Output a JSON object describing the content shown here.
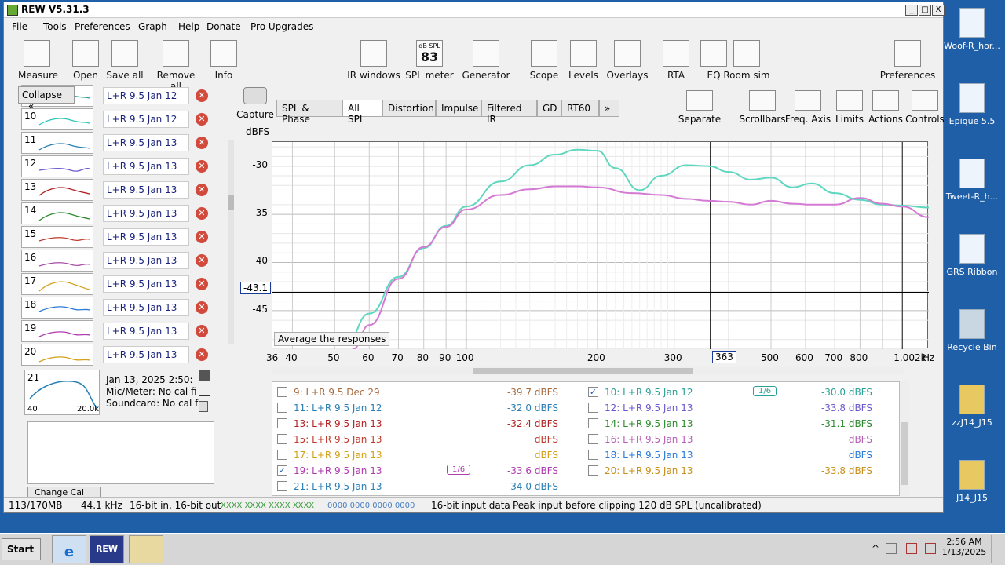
{
  "window": {
    "title": "REW V5.31.3",
    "min": "_",
    "max": "□",
    "close": "X"
  },
  "menu": [
    "File",
    "Tools",
    "Preferences",
    "Graph",
    "Help",
    "Donate",
    "Pro Upgrades"
  ],
  "toolbar_left": [
    {
      "label": "Measure",
      "icon": "measure-icon"
    },
    {
      "label": "Open",
      "icon": "folder-icon"
    },
    {
      "label": "Save all",
      "icon": "save-icon"
    },
    {
      "label": "Remove all",
      "icon": "remove-icon"
    },
    {
      "label": "Info",
      "icon": "info-icon"
    }
  ],
  "toolbar_right": [
    {
      "label": "IR windows",
      "icon": "ir-windows-icon"
    },
    {
      "label": "SPL meter",
      "icon": "spl-meter-icon",
      "display_top": "dB SPL",
      "display_value": "83"
    },
    {
      "label": "Generator",
      "icon": "generator-icon"
    },
    {
      "label": "Scope",
      "icon": "scope-icon"
    },
    {
      "label": "Levels",
      "icon": "levels-icon"
    },
    {
      "label": "Overlays",
      "icon": "overlays-icon"
    },
    {
      "label": "RTA",
      "icon": "rta-icon"
    },
    {
      "label": "EQ",
      "icon": "eq-icon"
    },
    {
      "label": "Room sim",
      "icon": "room-sim-icon"
    },
    {
      "label": "Preferences",
      "icon": "wrench-icon"
    }
  ],
  "left_panel": {
    "collapse_label": "Collapse",
    "collapse_arrows": "«",
    "measurements": [
      {
        "num": "",
        "name": "L+R 9.5 Jan 12",
        "color": "#2aa198"
      },
      {
        "num": "10",
        "name": "L+R 9.5 Jan 12",
        "color": "#2ec4b6"
      },
      {
        "num": "11",
        "name": "L+R 9.5 Jan 13",
        "color": "#2a7fb5"
      },
      {
        "num": "12",
        "name": "L+R 9.5 Jan 13",
        "color": "#6a5acd"
      },
      {
        "num": "13",
        "name": "L+R 9.5 Jan 13",
        "color": "#b22222"
      },
      {
        "num": "14",
        "name": "L+R 9.5 Jan 13",
        "color": "#2e8b2e"
      },
      {
        "num": "15",
        "name": "L+R 9.5 Jan 13",
        "color": "#c0392b"
      },
      {
        "num": "16",
        "name": "L+R 9.5 Jan 13",
        "color": "#a64ca6"
      },
      {
        "num": "17",
        "name": "L+R 9.5 Jan 13",
        "color": "#d4a017"
      },
      {
        "num": "18",
        "name": "L+R 9.5 Jan 13",
        "color": "#2b7bd8"
      },
      {
        "num": "19",
        "name": "L+R 9.5 Jan 13",
        "color": "#b03ab0"
      },
      {
        "num": "20",
        "name": "L+R 9.5 Jan 13",
        "color": "#d4a017"
      }
    ],
    "selected": {
      "num": "21",
      "date": "Jan 13, 2025 2:50:",
      "mic": "Mic/Meter: No cal fi",
      "soundcard": "Soundcard: No cal f",
      "xmin": "40",
      "xmax": "20.0k"
    },
    "change_cal": "Change Cal"
  },
  "capture_label": "Capture",
  "tabs": [
    "SPL & Phase",
    "All SPL",
    "Distortion",
    "Impulse",
    "Filtered IR",
    "GD",
    "RT60",
    "»"
  ],
  "selected_tab": "All SPL",
  "graph_tools": [
    {
      "label": "Separate",
      "icon": "separate-icon"
    },
    {
      "label": "Scrollbars",
      "icon": "scrollbars-icon"
    },
    {
      "label": "Freq. Axis",
      "icon": "freq-axis-icon"
    },
    {
      "label": "Limits",
      "icon": "limits-icon"
    },
    {
      "label": "Actions",
      "icon": "actions-icon"
    },
    {
      "label": "Controls",
      "icon": "controls-icon"
    }
  ],
  "average_button": "Average the responses",
  "chart_data": {
    "type": "line",
    "ylabel": "dBFS",
    "xlabel": "Hz",
    "xscale": "log",
    "xlim": [
      36,
      1150
    ],
    "ylim": [
      -49,
      -27.5
    ],
    "yticks": [
      "-30",
      "-35",
      "-40",
      "-45"
    ],
    "xticks": [
      "36",
      "40",
      "50",
      "60",
      "70",
      "80",
      "90",
      "100",
      "200",
      "300",
      "363",
      "400",
      "500",
      "600",
      "700",
      "800",
      "1.002k"
    ],
    "xunit": "Hz",
    "cursor": {
      "x": 363,
      "y": -43.1,
      "x_label": "363",
      "y_label": "-43.1"
    },
    "grid": true,
    "series": [
      {
        "color": "#5fd7c0",
        "x": [
          53,
          60,
          70,
          80,
          90,
          100,
          120,
          140,
          160,
          180,
          200,
          220,
          250,
          280,
          320,
          360,
          400,
          450,
          500,
          560,
          620,
          700,
          800,
          900,
          1000,
          1150
        ],
        "y": [
          -48.5,
          -45.3,
          -41.5,
          -38.5,
          -36.2,
          -34.2,
          -31.6,
          -29.9,
          -28.8,
          -28.3,
          -28.4,
          -30.2,
          -32.5,
          -31.0,
          -29.9,
          -30.0,
          -30.6,
          -31.4,
          -31.2,
          -32.2,
          -31.8,
          -32.8,
          -33.5,
          -34.0,
          -34.1,
          -34.3
        ]
      },
      {
        "color": "#d47ad4",
        "x": [
          55,
          60,
          70,
          80,
          90,
          100,
          120,
          140,
          160,
          180,
          200,
          240,
          280,
          320,
          360,
          400,
          450,
          500,
          560,
          620,
          700,
          800,
          900,
          1000,
          1150
        ],
        "y": [
          -49.0,
          -46.5,
          -41.7,
          -38.4,
          -36.3,
          -34.5,
          -33.0,
          -32.4,
          -32.1,
          -32.1,
          -32.2,
          -32.8,
          -33.0,
          -33.4,
          -33.6,
          -33.7,
          -34.0,
          -33.6,
          -33.9,
          -34.0,
          -34.0,
          -33.3,
          -33.9,
          -34.2,
          -35.3
        ]
      }
    ]
  },
  "legend": [
    {
      "name": "9: L+R 9.5 Dec 29",
      "value": "-39.7 dBFS",
      "checked": false,
      "color": "#a66a3f",
      "col": 0,
      "row": 0
    },
    {
      "name": "10: L+R 9.5 Jan 12",
      "value": "-30.0 dBFS",
      "checked": true,
      "color": "#2aa198",
      "col": 1,
      "row": 0,
      "smoothing": "1/6"
    },
    {
      "name": "11: L+R 9.5 Jan 12",
      "value": "-32.0 dBFS",
      "checked": false,
      "color": "#2a7fb5",
      "col": 0,
      "row": 1
    },
    {
      "name": "12: L+R 9.5 Jan 13",
      "value": "-33.8 dBFS",
      "checked": false,
      "color": "#6a5acd",
      "col": 1,
      "row": 1
    },
    {
      "name": "13: L+R 9.5 Jan 13",
      "value": "-32.4 dBFS",
      "checked": false,
      "color": "#b22222",
      "col": 0,
      "row": 2
    },
    {
      "name": "14: L+R 9.5 Jan 13",
      "value": "-31.1 dBFS",
      "checked": false,
      "color": "#2e8b2e",
      "col": 1,
      "row": 2
    },
    {
      "name": "15: L+R 9.5 Jan 13",
      "value": "dBFS",
      "checked": false,
      "color": "#c0392b",
      "col": 0,
      "row": 3
    },
    {
      "name": "16: L+R 9.5 Jan 13",
      "value": "dBFS",
      "checked": false,
      "color": "#b760b7",
      "col": 1,
      "row": 3
    },
    {
      "name": "17: L+R 9.5 Jan 13",
      "value": "dBFS",
      "checked": false,
      "color": "#d4a017",
      "col": 0,
      "row": 4
    },
    {
      "name": "18: L+R 9.5 Jan 13",
      "value": "dBFS",
      "checked": false,
      "color": "#2b7bd8",
      "col": 1,
      "row": 4
    },
    {
      "name": "19: L+R 9.5 Jan 13",
      "value": "-33.6 dBFS",
      "checked": true,
      "color": "#b03ab0",
      "col": 0,
      "row": 5,
      "smoothing": "1/6"
    },
    {
      "name": "20: L+R 9.5 Jan 13",
      "value": "-33.8 dBFS",
      "checked": false,
      "color": "#c8901a",
      "col": 1,
      "row": 5
    },
    {
      "name": "21: L+R 9.5 Jan 13",
      "value": "-34.0 dBFS",
      "checked": false,
      "color": "#2a7fb5",
      "col": 0,
      "row": 6
    }
  ],
  "status": {
    "memory": "113/170MB",
    "rate": "44.1 kHz",
    "bits": "16-bit in, 16-bit out",
    "levels_a": "XXXX XXXX  XXXX XXXX",
    "levels_b": "0000 0000  0000 0000",
    "input": "16-bit input data",
    "peak": "Peak input before clipping 120 dB SPL (uncalibrated)"
  },
  "desktop_icons": [
    {
      "label": "Woof-R_hor...",
      "icon": "document-icon"
    },
    {
      "label": "Epique 5.5",
      "icon": "document-icon"
    },
    {
      "label": "Tweet-R_h...",
      "icon": "document-icon"
    },
    {
      "label": "GRS Ribbon",
      "icon": "document-icon"
    },
    {
      "label": "Recycle Bin",
      "icon": "recycle-bin-icon"
    },
    {
      "label": "zzJ14_J15",
      "icon": "folder-icon"
    },
    {
      "label": "J14_J15",
      "icon": "folder-icon"
    }
  ],
  "taskbar": {
    "start": "Start",
    "apps": [
      {
        "label": "",
        "icon": "ie-icon"
      },
      {
        "label": "REW",
        "icon": "rew-icon"
      },
      {
        "label": "",
        "icon": "explorer-icon"
      }
    ],
    "time": "2:56 AM",
    "date": "1/13/2025"
  }
}
